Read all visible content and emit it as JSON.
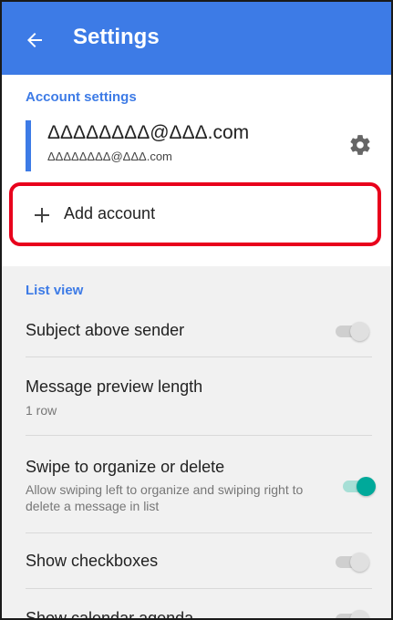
{
  "appbar": {
    "title": "Settings"
  },
  "account_section": {
    "header": "Account settings",
    "email": "ΔΔΔΔΔΔΔΔ@ΔΔΔ.com",
    "sub": "ΔΔΔΔΔΔΔΔ@ΔΔΔ.com",
    "add_label": "Add account"
  },
  "list_view": {
    "header": "List view",
    "items": [
      {
        "title": "Subject above sender",
        "sub": "",
        "switch": "off"
      },
      {
        "title": "Message preview length",
        "sub": "1 row"
      },
      {
        "title": "Swipe to organize or delete",
        "sub": "Allow swiping left to organize and swiping right to delete a message in list",
        "switch": "on"
      },
      {
        "title": "Show checkboxes",
        "sub": "",
        "switch": "off"
      },
      {
        "title": "Show calendar agenda",
        "sub": "",
        "switch": "off"
      }
    ]
  },
  "colors": {
    "accent": "#3d7be6",
    "toggle_on": "#00a99a",
    "highlight": "#e8001c"
  },
  "icons": [
    "back-arrow-icon",
    "gear-icon",
    "plus-icon"
  ]
}
